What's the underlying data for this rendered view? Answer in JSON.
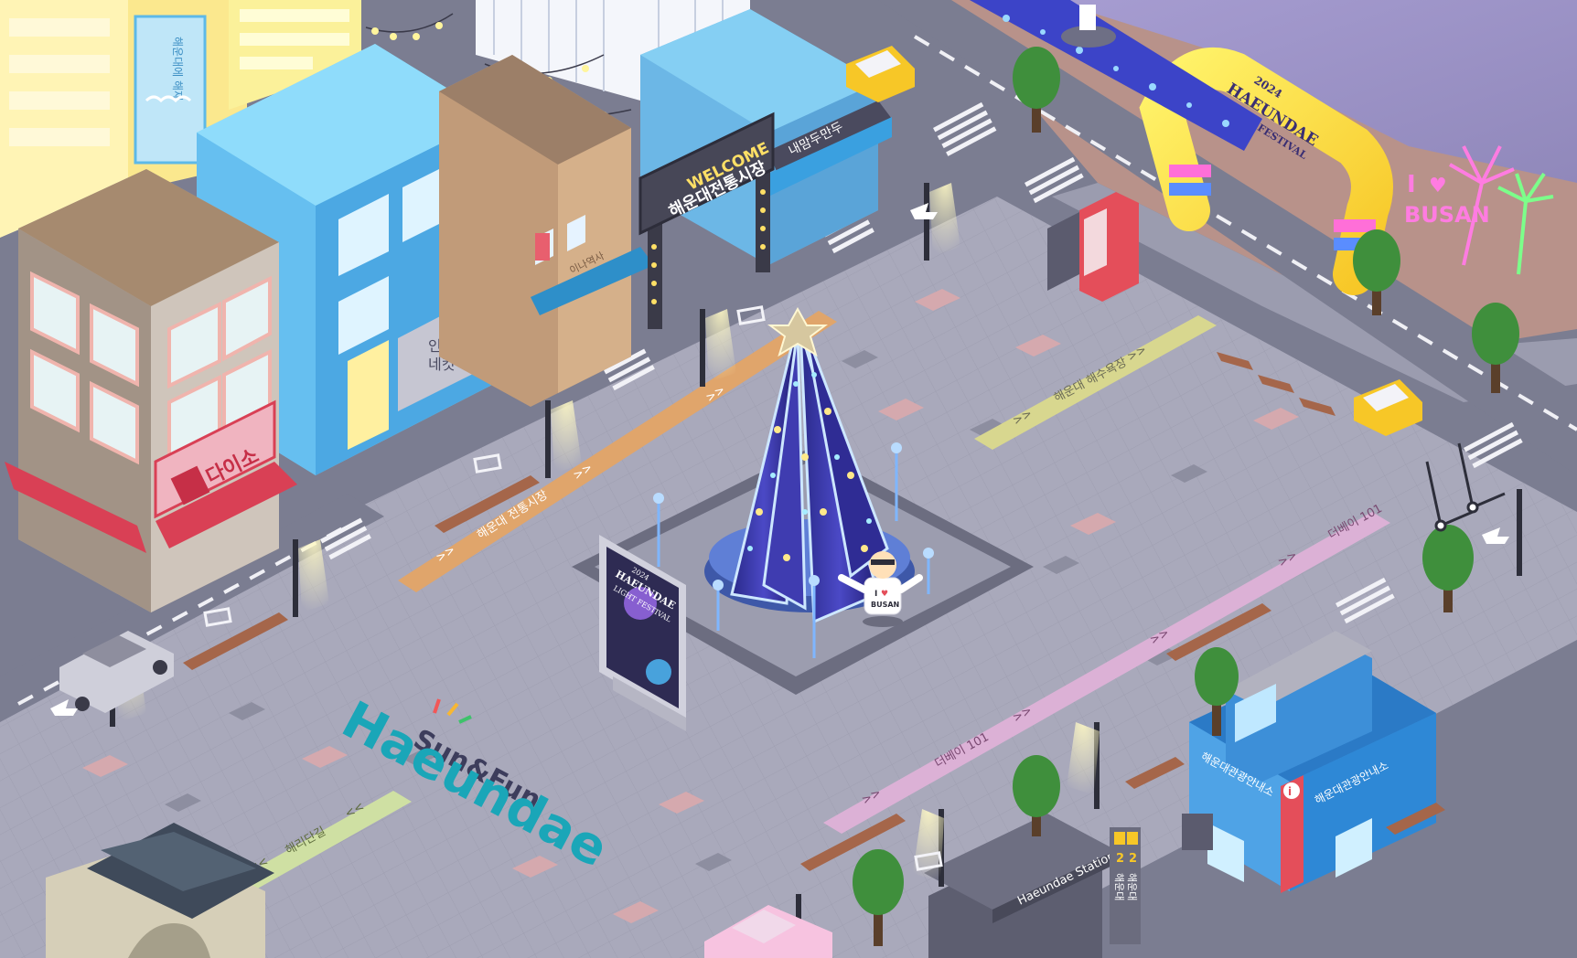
{
  "colors": {
    "sky": "#9f97c4",
    "beach": "#b8928a",
    "road": "#7b7d91",
    "plaza": "#a9a9bb",
    "plaza_dark": "#8d8ea0",
    "tile_pink": "#d5a9ae",
    "path_orange": "#e0a56b",
    "path_yellow": "#d8d78f",
    "path_pink": "#dcb1d6",
    "path_green": "#cfe0a3",
    "tree": "#3f8f3c",
    "neon_pink": "#ff7ce1",
    "neon_green": "#7cff8a"
  },
  "signs": {
    "welcome": "WELCOME",
    "market_name": "해운대전통시장",
    "shop_dumpling": "내맘두만두",
    "shop_daiso": "다이소",
    "shop_insaeng_line1": "인생",
    "shop_insaeng_line2": "네컷",
    "shop_small_sign": "이나역사",
    "billboard_text": "해운대에 해재",
    "i_love_busan_i": "I",
    "i_love_busan_text": "BUSAN",
    "arch_year": "2024",
    "arch_line1": "HAEUNDAE",
    "arch_line2": "LIGHT FESTIVAL",
    "poster_year": "2024",
    "poster_line1": "HAEUNDAE",
    "poster_line2": "LIGHT FESTIVAL",
    "mascot_shirt_i": "I",
    "mascot_shirt_text": "BUSAN",
    "logo_line1": "Sun&Fun",
    "logo_line2": "Haeundae",
    "station_name": "Haeundae Station",
    "info_center_left": "해운대관광안내소",
    "info_center_right": "해운대관광안내소",
    "info_icon": "i",
    "metro_number": "2",
    "metro_number_2": "2",
    "metro_text": "해운대",
    "metro_text_2": "해운대"
  },
  "paths": [
    {
      "label": "해운대 전통시장",
      "arrows": ">>"
    },
    {
      "label": "해운대 해수욕장",
      "arrows": ">>"
    },
    {
      "label": "더베이 101",
      "arrows": ">>"
    },
    {
      "label": "더베이 101",
      "arrows": ">>"
    },
    {
      "label": "해리단길",
      "arrows": "<<"
    }
  ]
}
